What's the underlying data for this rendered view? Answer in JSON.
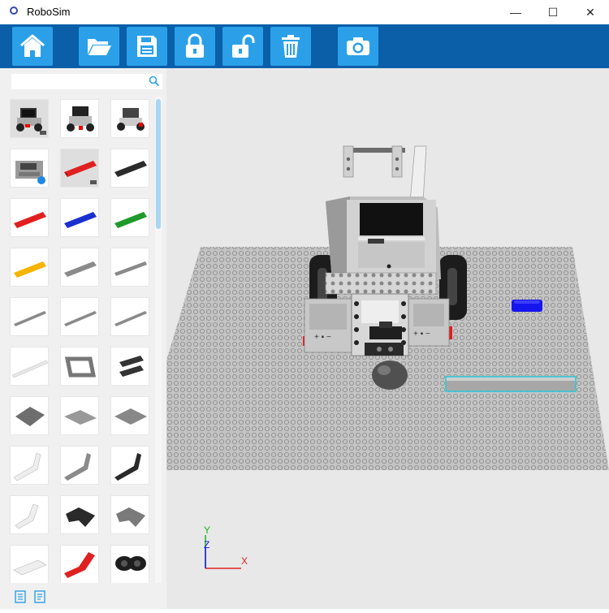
{
  "window": {
    "title": "RoboSim",
    "minimize": "—",
    "maximize": "☐",
    "close": "✕"
  },
  "toolbar": {
    "buttons": [
      {
        "name": "home",
        "icon": "home-icon"
      },
      {
        "name": "open",
        "icon": "folder-icon"
      },
      {
        "name": "save",
        "icon": "save-icon"
      },
      {
        "name": "lock",
        "icon": "lock-icon"
      },
      {
        "name": "unlock",
        "icon": "unlock-icon"
      },
      {
        "name": "delete",
        "icon": "trash-icon"
      },
      {
        "name": "screenshot",
        "icon": "camera-icon"
      }
    ]
  },
  "parts_panel": {
    "search": {
      "value": "",
      "placeholder": ""
    },
    "items": [
      "robot-part",
      "robot-part",
      "robot-part",
      "brick-gray-part",
      "beam-red-part",
      "beam-black-part",
      "beam-red-part",
      "beam-blue-part",
      "beam-green-part",
      "beam-yellow-part",
      "beam-gray-part",
      "beam-gray-part",
      "beam-gray-part",
      "beam-gray-part",
      "beam-gray-part",
      "beam-white-part",
      "frame-gray-part",
      "frame-black-part",
      "plate-gray-part",
      "plate-gray-part",
      "plate-gray-part",
      "angle-beam-white-part",
      "angle-beam-gray-part",
      "angle-beam-black-part",
      "angle-beam-white-part",
      "angle-beam-black-part",
      "angle-beam-gray-part",
      "angle-beam-white-part",
      "angle-beam-red-part",
      "connector-black-part"
    ]
  },
  "axes": {
    "x": "X",
    "y": "Y",
    "z": "Z"
  },
  "colors": {
    "toolbar_bg": "#0a5fa8",
    "button_bg": "#2ba0e8",
    "accent_blue": "#0000ee",
    "selection_cyan": "#27c9d8"
  }
}
